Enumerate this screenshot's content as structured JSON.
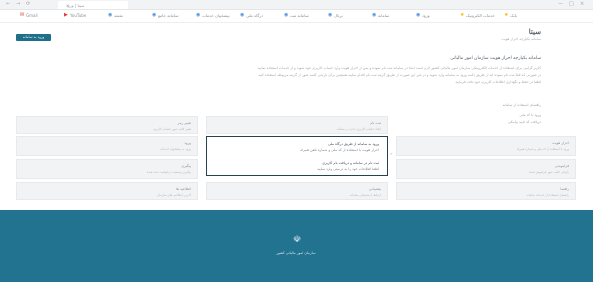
{
  "browser": {
    "tab_title": "سیتا | ورود",
    "tab_close": "×",
    "window_controls": [
      "—",
      "□",
      "×"
    ],
    "nav_icons": [
      "←",
      "→",
      "⟳"
    ],
    "bookmarks": [
      {
        "icon": "✉",
        "color": "#d93025",
        "label": "Gmail"
      },
      {
        "icon": "▶",
        "color": "#e53935",
        "label": "YouTube"
      },
      {
        "icon": "◉",
        "color": "#4a90d9",
        "label": "نقشه"
      },
      {
        "icon": "◉",
        "color": "#4a90d9",
        "label": "سامانه جامع"
      },
      {
        "icon": "◉",
        "color": "#4a90d9",
        "label": "پیشخوان خدمات"
      },
      {
        "icon": "◉",
        "color": "#4a90d9",
        "label": "درگاه ملی"
      },
      {
        "icon": "◉",
        "color": "#4a90d9",
        "label": "سامانه ثبت"
      },
      {
        "icon": "◉",
        "color": "#4a90d9",
        "label": "پرتال"
      },
      {
        "icon": "◉",
        "color": "#4a90d9",
        "label": "سامانه"
      },
      {
        "icon": "◉",
        "color": "#4a90d9",
        "label": "ورود"
      },
      {
        "icon": "★",
        "color": "#f4b400",
        "label": "خدمات الکترونیک"
      },
      {
        "icon": "★",
        "color": "#f4b400",
        "label": "بانک"
      }
    ]
  },
  "header": {
    "site_title": "سیتا",
    "site_subtitle": "سامانه یکپارچه احراز هویت",
    "login_button": "ورود به سامانه"
  },
  "intro": {
    "headline": "سامانه یکپارچه احراز هویت سازمان امور مالیاتی",
    "paragraphs": [
      "کاربر گرامی برای استفاده از خدمات الکترونیکی سازمان امور مالیاتی کشور لازم است ابتدا در سامانه ثبت نام نموده و پس از احراز هویت وارد حساب کاربری خود شوید و از خدمات استفاده نمایید",
      "در صورتی که قبلا ثبت نام نموده اید از طریق دکمه ورود به سامانه وارد شوید و در غیر این صورت از طریق گزینه ثبت نام اقدام نمایید همچنین برای بازیابی کلمه عبور از گزینه مربوطه استفاده کنید",
      "لطفا در حفظ و نگهداری اطلاعات کاربری خود دقت فرمایید"
    ],
    "note_title": "راهنمای استفاده از سامانه",
    "note_lines": [
      "ورود با کد ملی",
      "دریافت کد تایید پیامکی"
    ]
  },
  "cards": [
    {
      "title": "احراز هویت",
      "desc": "ورود با استفاده از کد ملی و شماره همراه"
    },
    {
      "title": "ثبت نام",
      "desc": "ایجاد حساب کاربری جدید در سامانه"
    },
    {
      "title": "تغییر رمز",
      "desc": "تغییر کلمه عبور حساب کاربری"
    },
    {
      "title": "فراموشی",
      "desc": "بازیابی کلمه عبور فراموش شده"
    },
    {
      "title": "ورود",
      "desc": "ورود به پیشخوان خدمات"
    },
    {
      "title": "پیگیری",
      "desc": "پیگیری وضعیت درخواست ثبت شده"
    },
    {
      "title": "راهنما",
      "desc": "راهنمای استفاده از خدمات سامانه"
    },
    {
      "title": "پشتیبانی",
      "desc": "ارتباط با پشتیبانی سامانه"
    },
    {
      "title": "اطلاعیه ها",
      "desc": "آخرین اطلاعیه های سازمان"
    }
  ],
  "selected_card": {
    "line1": "ورود به سامانه از طریق درگاه ملی",
    "line2": "احراز هویت با استفاده از کد ملی و شماره تلفن همراه",
    "line3": "ثبت نام در سامانه و دریافت نام کاربری",
    "line4": "لطفا اطلاعات خود را به درستی وارد نمایید"
  },
  "hint": {
    "marker": "✓"
  },
  "footer": {
    "emblem": "☫",
    "text": "سازمان امور مالیاتی کشور"
  },
  "colors": {
    "accent": "#1f6f8b",
    "footer": "#21738f",
    "selected_border": "#26424f"
  }
}
